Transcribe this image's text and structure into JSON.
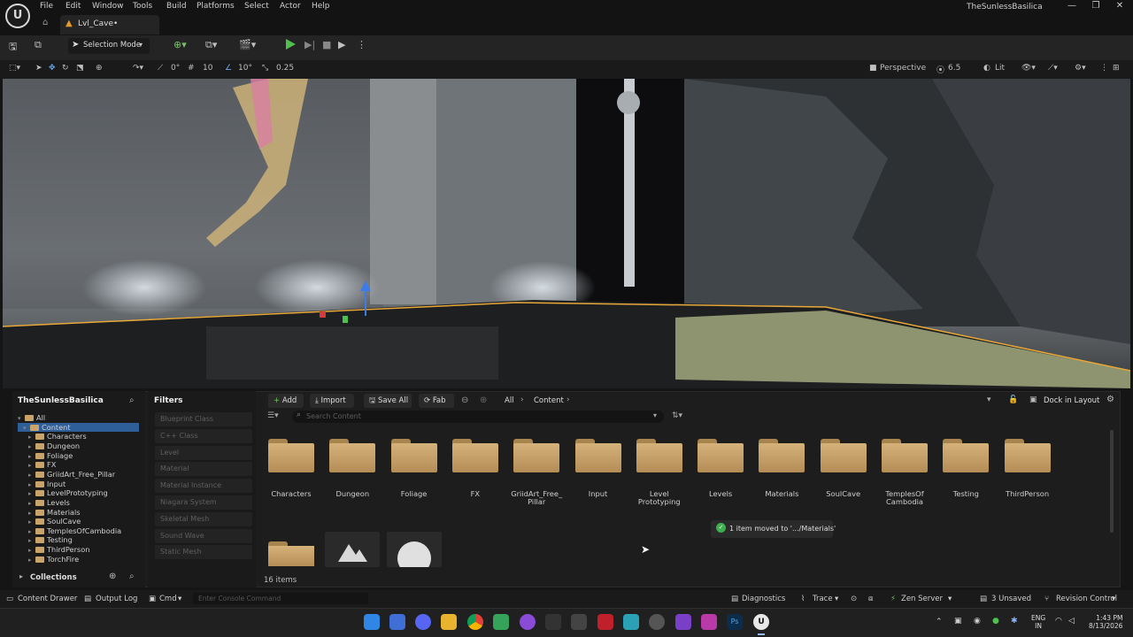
{
  "menu": {
    "file": "File",
    "edit": "Edit",
    "window": "Window",
    "tools": "Tools",
    "build": "Build",
    "platforms": "Platforms",
    "select": "Select",
    "actor": "Actor",
    "help": "Help"
  },
  "project_name": "TheSunlessBasilica",
  "level_tab": "Lvl_Cave•",
  "toolbar": {
    "selection_mode": "Selection Mode"
  },
  "viewport": {
    "perspective": "Perspective",
    "camera_speed": "6.5",
    "lit": "Lit",
    "rotation_snap": "0°",
    "grid_snap": "10",
    "angle_snap": "10°",
    "scale_snap": "0.25"
  },
  "content_browser": {
    "project_root": "TheSunlessBasilica",
    "filters_title": "Filters",
    "add": "Add",
    "import": "Import",
    "save_all": "Save All",
    "fab": "Fab",
    "crumb_all": "All",
    "crumb_content": "Content",
    "dock_in_layout": "Dock in Layout",
    "search_placeholder": "Search Content",
    "tree": [
      {
        "label": "All",
        "level": 0
      },
      {
        "label": "Content",
        "level": 1
      },
      {
        "label": "Characters",
        "level": 2
      },
      {
        "label": "Dungeon",
        "level": 2
      },
      {
        "label": "Foliage",
        "level": 2
      },
      {
        "label": "FX",
        "level": 2
      },
      {
        "label": "GriidArt_Free_Pillar",
        "level": 2
      },
      {
        "label": "Input",
        "level": 2
      },
      {
        "label": "LevelPrototyping",
        "level": 2
      },
      {
        "label": "Levels",
        "level": 2
      },
      {
        "label": "Materials",
        "level": 2
      },
      {
        "label": "SoulCave",
        "level": 2
      },
      {
        "label": "TemplesOfCambodia",
        "level": 2
      },
      {
        "label": "Testing",
        "level": 2
      },
      {
        "label": "ThirdPerson",
        "level": 2
      },
      {
        "label": "TorchFire",
        "level": 2
      }
    ],
    "filters": [
      "Blueprint Class",
      "C++ Class",
      "Level",
      "Material",
      "Material Instance",
      "Niagara System",
      "Skeletal Mesh",
      "Sound Wave",
      "Static Mesh"
    ],
    "folders": [
      {
        "l1": "Characters",
        "l2": ""
      },
      {
        "l1": "Dungeon",
        "l2": ""
      },
      {
        "l1": "Foliage",
        "l2": ""
      },
      {
        "l1": "FX",
        "l2": ""
      },
      {
        "l1": "GriidArt_Free_",
        "l2": "Pillar"
      },
      {
        "l1": "Input",
        "l2": ""
      },
      {
        "l1": "Level",
        "l2": "Prototyping"
      },
      {
        "l1": "Levels",
        "l2": ""
      },
      {
        "l1": "Materials",
        "l2": ""
      },
      {
        "l1": "SoulCave",
        "l2": ""
      },
      {
        "l1": "TemplesOf",
        "l2": "Cambodia"
      },
      {
        "l1": "Testing",
        "l2": ""
      },
      {
        "l1": "ThirdPerson",
        "l2": ""
      }
    ],
    "toast": "1 item moved to '.../Materials'",
    "item_count": "16 items",
    "collections": "Collections"
  },
  "statusbar": {
    "content_drawer": "Content Drawer",
    "output_log": "Output Log",
    "cmd": "Cmd",
    "console_placeholder": "Enter Console Command",
    "diagnostics": "Diagnostics",
    "trace": "Trace",
    "zen_server": "Zen Server",
    "unsaved": "3 Unsaved",
    "revision_control": "Revision Control"
  },
  "tray": {
    "lang1": "ENG",
    "lang2": "IN",
    "time": "1:43 PM",
    "date": "8/13/2026"
  },
  "colors": {
    "accent_folder": "#c9a46a",
    "play_green": "#4fbf4f",
    "selection_outline": "#e8a83a",
    "toast_check": "#3fae4f"
  }
}
